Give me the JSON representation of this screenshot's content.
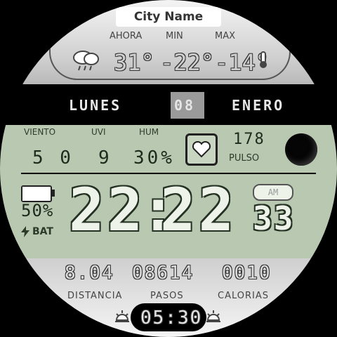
{
  "top": {
    "city": "City Name",
    "labels": {
      "now": "AHORA",
      "min": "MIN",
      "max": "MAX"
    },
    "values": {
      "now": "31°",
      "min": "-22°",
      "max": "-14°"
    }
  },
  "date": {
    "day": "LUNES",
    "date": "08",
    "month": "ENERO"
  },
  "stats": {
    "labels": {
      "wind": "VIENTO",
      "uvi": "UVI",
      "hum": "HUM"
    },
    "values": {
      "wind": "5 0",
      "uvi": "9",
      "hum": "30%"
    },
    "pulse_value": "178",
    "pulse_label": "PULSO"
  },
  "battery": {
    "percent": "50%",
    "label": "BAT",
    "level": 0.5
  },
  "time": {
    "hh": "22",
    "mm": "22",
    "ss": "33",
    "ampm": "AM"
  },
  "activity": {
    "distance": "8.04",
    "steps": "08614",
    "calories": "0010",
    "distance_label": "DISTANCIA",
    "steps_label": "PASOS",
    "calories_label": "CALORIAS"
  },
  "sun": {
    "time": "05:30"
  }
}
